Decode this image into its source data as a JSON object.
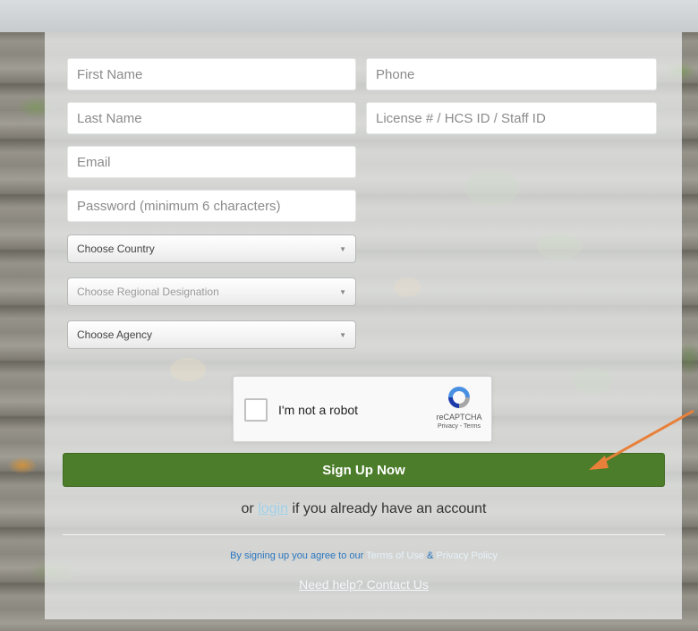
{
  "form": {
    "first_name_placeholder": "First Name",
    "last_name_placeholder": "Last Name",
    "email_placeholder": "Email",
    "password_placeholder": "Password (minimum 6 characters)",
    "phone_placeholder": "Phone",
    "license_placeholder": "License # / HCS ID / Staff ID",
    "country_select": "Choose Country",
    "region_select": "Choose Regional Designation",
    "agency_select": "Choose Agency"
  },
  "recaptcha": {
    "label": "I'm not a robot",
    "brand": "reCAPTCHA",
    "links": "Privacy - Terms"
  },
  "actions": {
    "signup_label": "Sign Up Now",
    "login_prefix": "or",
    "login_link": "login",
    "login_suffix": "if you already have an account"
  },
  "footer": {
    "terms_prefix": "By signing up you agree to our",
    "terms_link": "Terms of Use",
    "terms_amp": "&",
    "privacy_link": "Privacy Policy",
    "help_link": "Need help? Contact Us"
  },
  "colors": {
    "signup_green": "#4c7d2a",
    "link_blue": "#2a76bf",
    "arrow_orange": "#e8803a"
  },
  "icons": {
    "dropdown": "caret-down-icon",
    "recaptcha": "recaptcha-logo-icon",
    "pointer": "annotation-arrow-icon"
  }
}
